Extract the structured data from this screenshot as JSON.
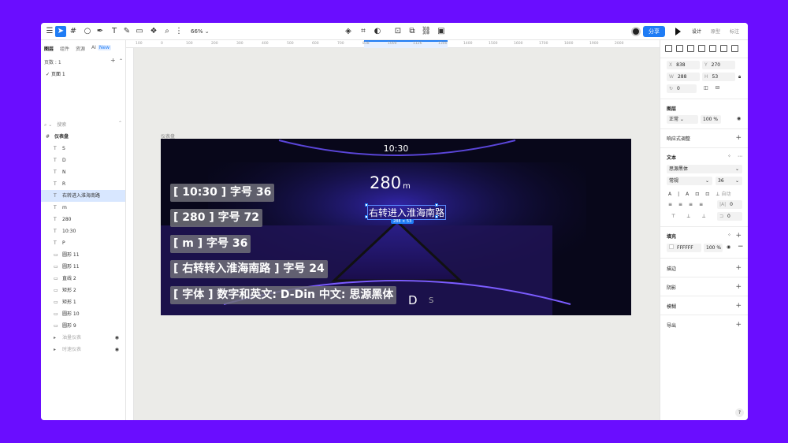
{
  "toolbar": {
    "zoom": "66%",
    "share_label": "分享",
    "modes": [
      "设计",
      "原型",
      "标注"
    ]
  },
  "left_panel": {
    "tabs": [
      "图层",
      "组件",
      "资源",
      "AI"
    ],
    "ai_badge": "New",
    "pages_label": "页数 : 1",
    "page_name": "页面 1",
    "search_placeholder": "搜索",
    "layers": [
      {
        "name": "仪表盘",
        "type": "frame"
      },
      {
        "name": "S",
        "type": "text"
      },
      {
        "name": "D",
        "type": "text"
      },
      {
        "name": "N",
        "type": "text"
      },
      {
        "name": "R",
        "type": "text"
      },
      {
        "name": "右转进入淮海南路",
        "type": "text",
        "selected": true
      },
      {
        "name": "m",
        "type": "text"
      },
      {
        "name": "280",
        "type": "text"
      },
      {
        "name": "10:30",
        "type": "text"
      },
      {
        "name": "P",
        "type": "text"
      },
      {
        "name": "圆形 11",
        "type": "shape"
      },
      {
        "name": "圆形 11",
        "type": "shape"
      },
      {
        "name": "直线 2",
        "type": "shape"
      },
      {
        "name": "矩形 2",
        "type": "shape"
      },
      {
        "name": "矩形 1",
        "type": "shape"
      },
      {
        "name": "圆形 10",
        "type": "shape"
      },
      {
        "name": "圆形 9",
        "type": "shape"
      },
      {
        "name": "油量仪表",
        "type": "group",
        "dim": true
      },
      {
        "name": "时速仪表",
        "type": "group",
        "dim": true
      }
    ]
  },
  "ruler": {
    "ticks": [
      "100",
      "0",
      "100",
      "200",
      "300",
      "400",
      "500",
      "600",
      "700",
      "838",
      "1000",
      "1126",
      "1300",
      "1400",
      "1500",
      "1600",
      "1700",
      "1800",
      "1900",
      "2000"
    ]
  },
  "canvas": {
    "frame_label": "仪表盘",
    "time": "10:30",
    "distance": "280",
    "distance_unit": "m",
    "road": "右转进入淮海南路",
    "selection_size": "288 × 53",
    "gear_d": "D",
    "gear_s": "S",
    "notes": [
      "[ 10:30 ]  字号 36",
      "[ 280 ]  字号 72",
      "[ m ]  字号  36",
      "[ 右转转入淮海南路 ]  字号 24",
      "[ 字体 ]   数字和英文: D-Din  中文: 思源黑体"
    ]
  },
  "right_panel": {
    "x": "838",
    "y": "270",
    "w": "288",
    "h": "53",
    "rotation": "0",
    "layer_title": "图层",
    "blend_mode": "正常",
    "opacity": "100",
    "opacity_unit": "%",
    "responsive_label": "响应式调整",
    "text_title": "文本",
    "font_family": "思源黑体",
    "font_weight": "常规",
    "font_size": "36",
    "auto_label": "自动",
    "spacing_value_1": "0",
    "spacing_value_2": "0",
    "fill_title": "填充",
    "fill_color_label": "FFFFFF",
    "fill_opacity": "100",
    "stroke_title": "描边",
    "shadow_title": "阴影",
    "blur_title": "模糊",
    "export_title": "导出",
    "help_label": "?"
  },
  "colors": {
    "accent": "#1f7cf5",
    "background": "#6a0dff",
    "dashboard": "#08071a"
  }
}
